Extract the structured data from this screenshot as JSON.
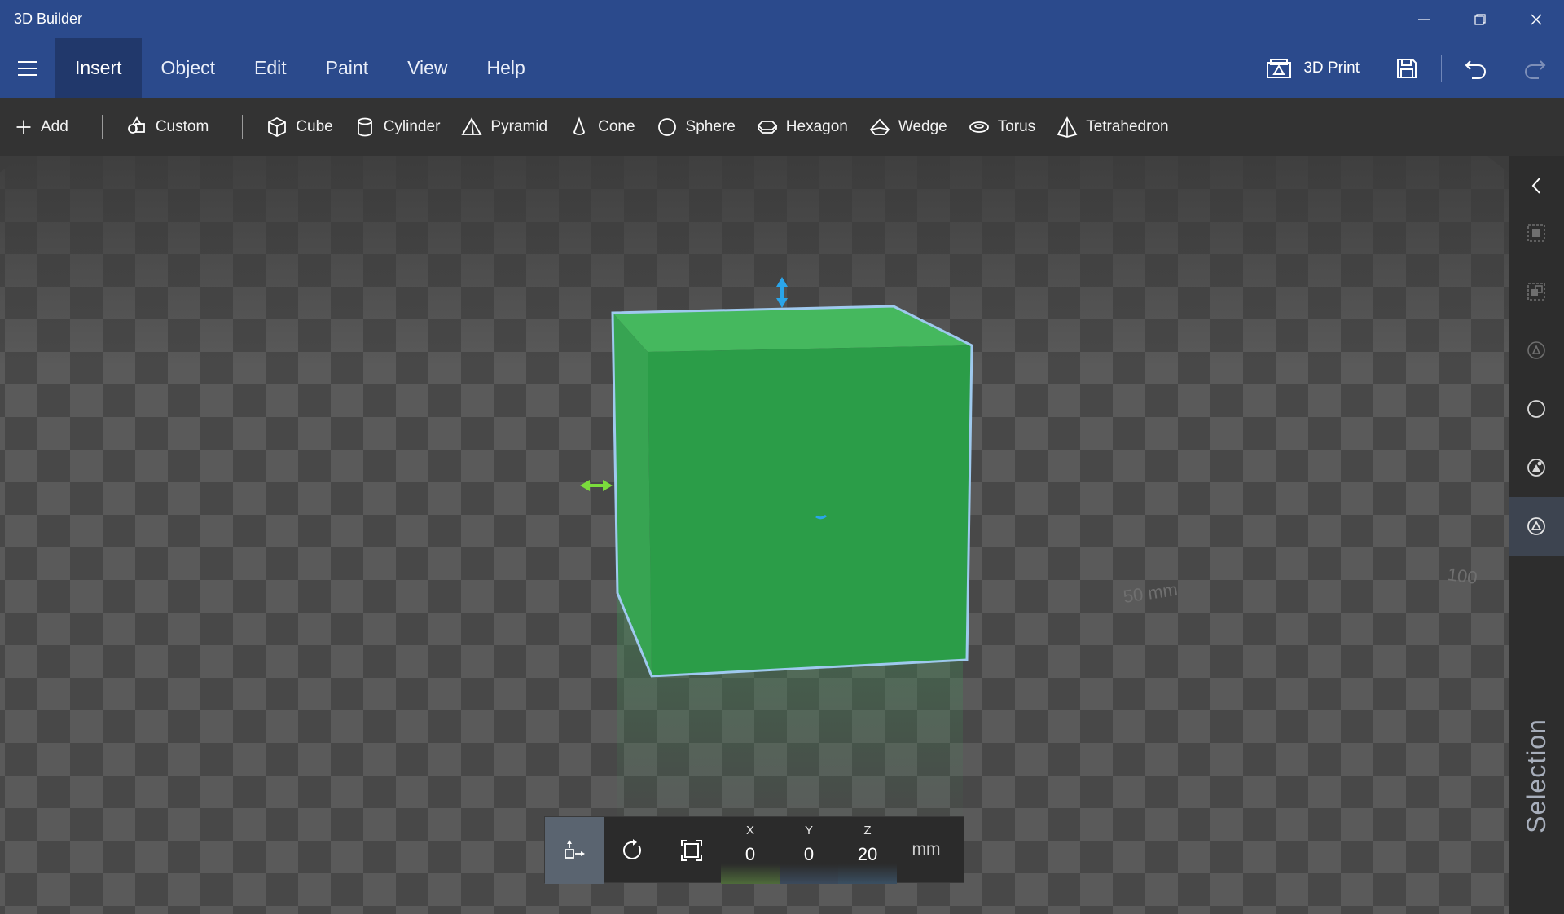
{
  "app": {
    "title": "3D Builder"
  },
  "menu": {
    "tabs": [
      {
        "label": "Insert",
        "active": true
      },
      {
        "label": "Object"
      },
      {
        "label": "Edit"
      },
      {
        "label": "Paint"
      },
      {
        "label": "View"
      },
      {
        "label": "Help"
      }
    ],
    "print_label": "3D Print"
  },
  "toolbar": {
    "add_label": "Add",
    "custom_label": "Custom",
    "shapes": [
      {
        "label": "Cube",
        "icon": "cube-icon"
      },
      {
        "label": "Cylinder",
        "icon": "cylinder-icon"
      },
      {
        "label": "Pyramid",
        "icon": "pyramid-icon"
      },
      {
        "label": "Cone",
        "icon": "cone-icon"
      },
      {
        "label": "Sphere",
        "icon": "sphere-icon"
      },
      {
        "label": "Hexagon",
        "icon": "hexagon-icon"
      },
      {
        "label": "Wedge",
        "icon": "wedge-icon"
      },
      {
        "label": "Torus",
        "icon": "torus-icon"
      },
      {
        "label": "Tetrahedron",
        "icon": "tetrahedron-icon"
      }
    ]
  },
  "viewport": {
    "grid_labels": [
      "50 mm",
      "100"
    ],
    "object_color": "#2f9e4a"
  },
  "transform": {
    "x_label": "X",
    "x_value": "0",
    "y_label": "Y",
    "y_value": "0",
    "z_label": "Z",
    "z_value": "20",
    "unit": "mm"
  },
  "sidepanel": {
    "label": "Selection"
  }
}
